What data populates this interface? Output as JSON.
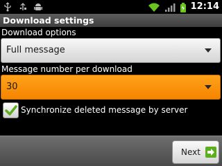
{
  "status_bar": {
    "time": "12:14",
    "left_icons": [
      "usb-icon",
      "usb-debug-icon",
      "android-icon"
    ],
    "right_icons": [
      "wifi-icon",
      "signal-icon",
      "battery-icon"
    ]
  },
  "title_bar": {
    "title": "Download settings"
  },
  "download_options": {
    "label": "Download options",
    "value": "Full message"
  },
  "message_number": {
    "label": "Message number per download",
    "value": "30"
  },
  "sync_deleted": {
    "label": "Synchronize deleted message by server",
    "checked": true
  },
  "footer": {
    "next_label": "Next",
    "next_icon": "arrow-right-icon"
  },
  "colors": {
    "focus_orange": "#f68400",
    "check_green": "#5cae1e",
    "background": "#000000"
  }
}
